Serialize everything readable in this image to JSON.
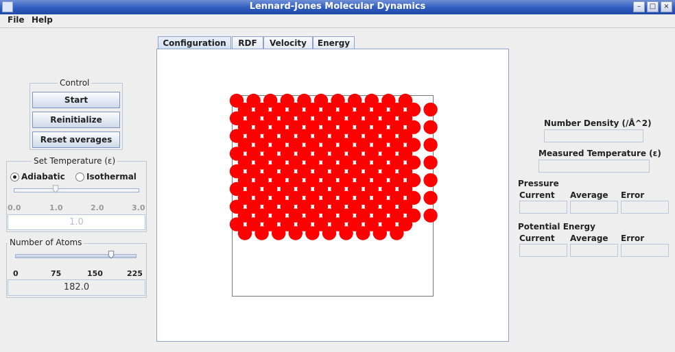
{
  "window": {
    "title": "Lennard-Jones Molecular Dynamics",
    "controls": [
      "minimize-icon",
      "maximize-icon",
      "close-icon"
    ]
  },
  "menubar": {
    "file": "File",
    "help": "Help"
  },
  "control": {
    "legend": "Control",
    "start": "Start",
    "reinitialize": "Reinitialize",
    "reset": "Reset averages"
  },
  "temperature": {
    "legend": "Set Temperature (ε)",
    "adiabatic": "Adiabatic",
    "isothermal": "Isothermal",
    "selected_mode": "Adiabatic",
    "ticks": [
      "0.0",
      "1.0",
      "2.0",
      "3.0"
    ],
    "slider_value": 1.0,
    "slider_min": 0.0,
    "slider_max": 3.0,
    "value": "1.0"
  },
  "atoms": {
    "legend": "Number of Atoms",
    "ticks": [
      "0",
      "75",
      "150",
      "225"
    ],
    "slider_value": 182,
    "slider_min": 0,
    "slider_max": 225,
    "value": "182.0"
  },
  "tabs": [
    "Configuration",
    "RDF",
    "Velocity",
    "Energy"
  ],
  "selected_tab": "Configuration",
  "atom_color": "#ff0000",
  "stats": {
    "number_density": "Number Density (/Å^2)",
    "measured_temp": "Measured Temperature (ε)",
    "pressure": "Pressure",
    "potential_energy": "Potential Energy",
    "current": "Current",
    "average": "Average",
    "error": "Error"
  }
}
